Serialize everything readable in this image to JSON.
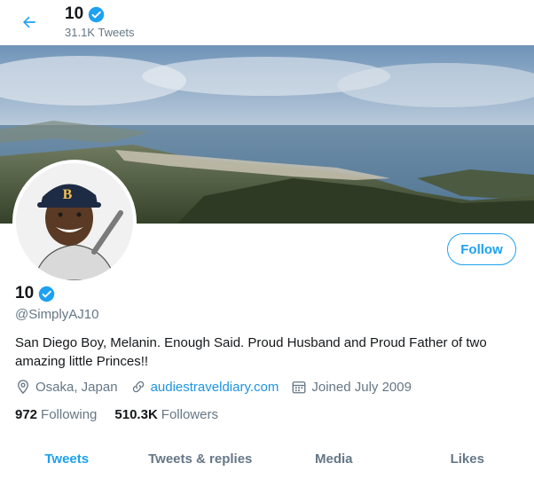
{
  "header": {
    "name": "10",
    "tweet_count": "31.1K Tweets"
  },
  "profile": {
    "name": "10",
    "handle": "@SimplyAJ10",
    "follow_label": "Follow",
    "bio": "San Diego Boy, Melanin. Enough Said. Proud Husband and Proud Father of two amazing little Princes!!",
    "location": "Osaka, Japan",
    "website": "audiestraveldiary.com",
    "joined": "Joined July 2009",
    "following_count": "972",
    "following_label": "Following",
    "followers_count": "510.3K",
    "followers_label": "Followers"
  },
  "tabs": [
    {
      "label": "Tweets"
    },
    {
      "label": "Tweets & replies"
    },
    {
      "label": "Media"
    },
    {
      "label": "Likes"
    }
  ],
  "colors": {
    "accent": "#1da1f2",
    "link": "#1b95e0",
    "secondary_text": "#657786"
  },
  "icons": [
    "back-arrow-icon",
    "verified-badge-icon",
    "location-pin-icon",
    "link-icon",
    "calendar-icon"
  ]
}
